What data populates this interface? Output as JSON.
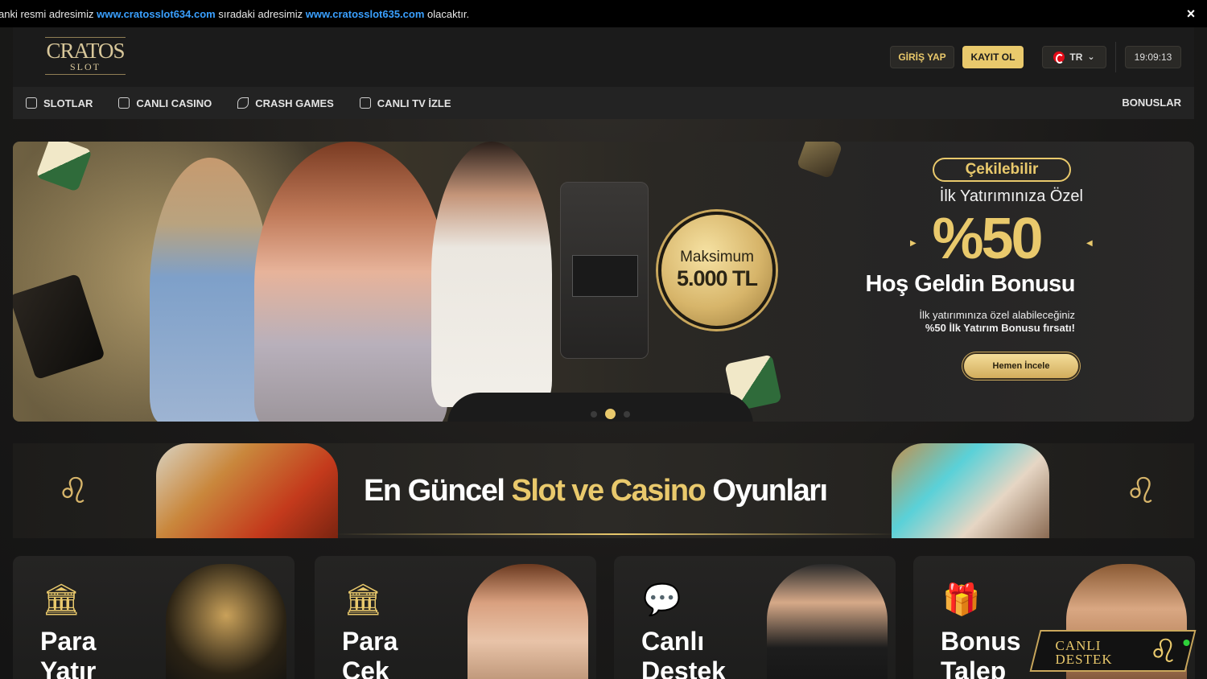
{
  "announcement": {
    "prefix": "anki resmi adresimiz",
    "current_url": "www.cratosslot634.com",
    "middle": "sıradaki adresimiz",
    "next_url": "www.cratosslot635.com",
    "suffix": "olacaktır.",
    "close_icon": "×"
  },
  "header": {
    "logo_top": "CRATOS",
    "logo_bottom": "SLOT",
    "login_label": "GİRİŞ YAP",
    "register_label": "KAYIT OL",
    "language": "TR",
    "language_chevron": "⌄",
    "clock": "19:09:13"
  },
  "nav": {
    "items": [
      {
        "label": "SLOTLAR",
        "icon": "slot-machine-icon"
      },
      {
        "label": "CANLI CASINO",
        "icon": "cards-icon"
      },
      {
        "label": "CRASH GAMES",
        "icon": "rocket-icon"
      },
      {
        "label": "CANLI TV İZLE",
        "icon": "tv-icon"
      }
    ],
    "right_label": "BONUSLAR"
  },
  "hero": {
    "coin_line1": "Maksimum",
    "coin_line2": "5.000 TL",
    "badge": "Çekilebilir",
    "subtitle": "İlk Yatırımınıza Özel",
    "big": "%50",
    "title": "Hoş Geldin Bonusu",
    "desc_line1": "İlk yatırımınıza özel alabileceğiniz",
    "desc_line2": "%50 İlk Yatırım Bonusu fırsatı!",
    "button": "Hemen İncele",
    "slides_count": 3,
    "active_slide": 2
  },
  "banner2": {
    "title_white1": "En Güncel",
    "title_gold": "Slot ve Casino",
    "title_white2": "Oyunları",
    "lion_glyph": "♌"
  },
  "cards": [
    {
      "line1": "Para",
      "line2": "Yatır",
      "icon": "bank-icon",
      "glyph": "🏛"
    },
    {
      "line1": "Para",
      "line2": "Çek",
      "icon": "bank-icon",
      "glyph": "🏛"
    },
    {
      "line1": "Canlı",
      "line2": "Destek",
      "icon": "chat-icon",
      "glyph": "💬"
    },
    {
      "line1": "Bonus",
      "line2": "Talep",
      "icon": "gift-icon",
      "glyph": "🎁"
    }
  ],
  "live_support": {
    "line1": "CANLI",
    "line2": "DESTEK",
    "glyph": "♌"
  },
  "colors": {
    "gold": "#e9c96c",
    "link_blue": "#3aa0ff",
    "bg_dark": "#1b1b1b"
  }
}
